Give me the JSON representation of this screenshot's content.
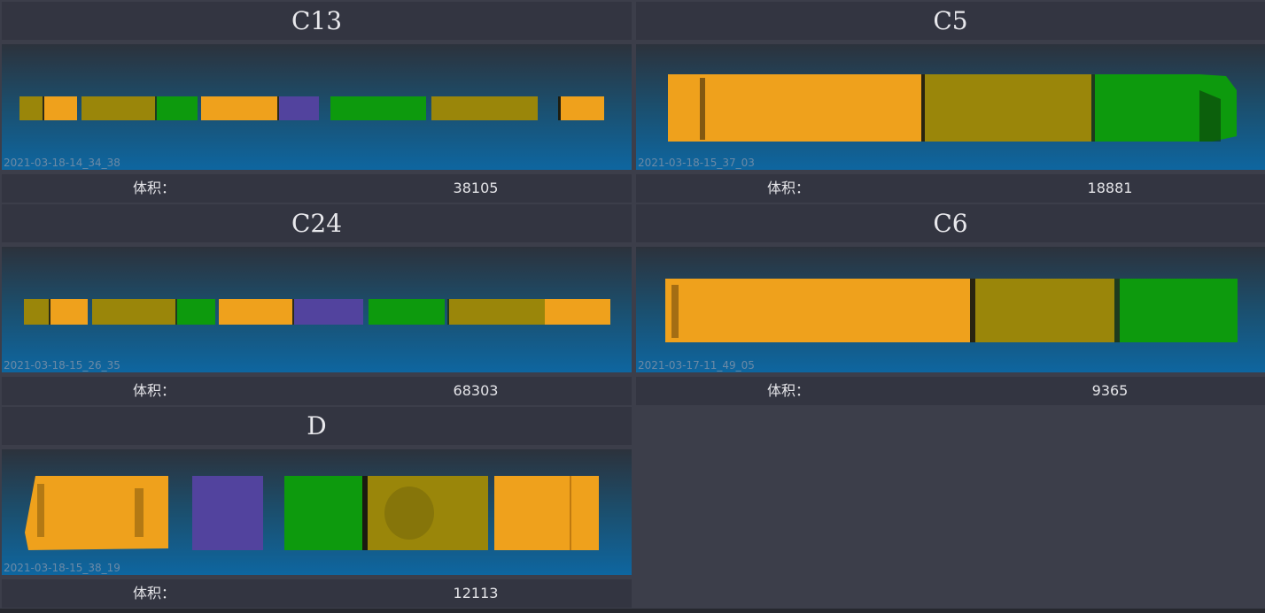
{
  "colors": {
    "orange": "#efa11c",
    "olive": "#9a860a",
    "green": "#0d9a0d",
    "purple": "#52439e",
    "panel_bg": "#333541",
    "page_bg": "#3c3e4a"
  },
  "panels": [
    {
      "title": "C13",
      "timestamp": "2021-03-18-14_34_38",
      "volume_label": "体积：",
      "volume_value": "38105"
    },
    {
      "title": "C5",
      "timestamp": "2021-03-18-15_37_03",
      "volume_label": "体积：",
      "volume_value": "18881"
    },
    {
      "title": "C24",
      "timestamp": "2021-03-18-15_26_35",
      "volume_label": "体积：",
      "volume_value": "68303"
    },
    {
      "title": "C6",
      "timestamp": "2021-03-17-11_49_05",
      "volume_label": "体积：",
      "volume_value": "9365"
    },
    {
      "title": "D",
      "timestamp": "2021-03-18-15_38_19",
      "volume_label": "体积：",
      "volume_value": "12113"
    }
  ]
}
